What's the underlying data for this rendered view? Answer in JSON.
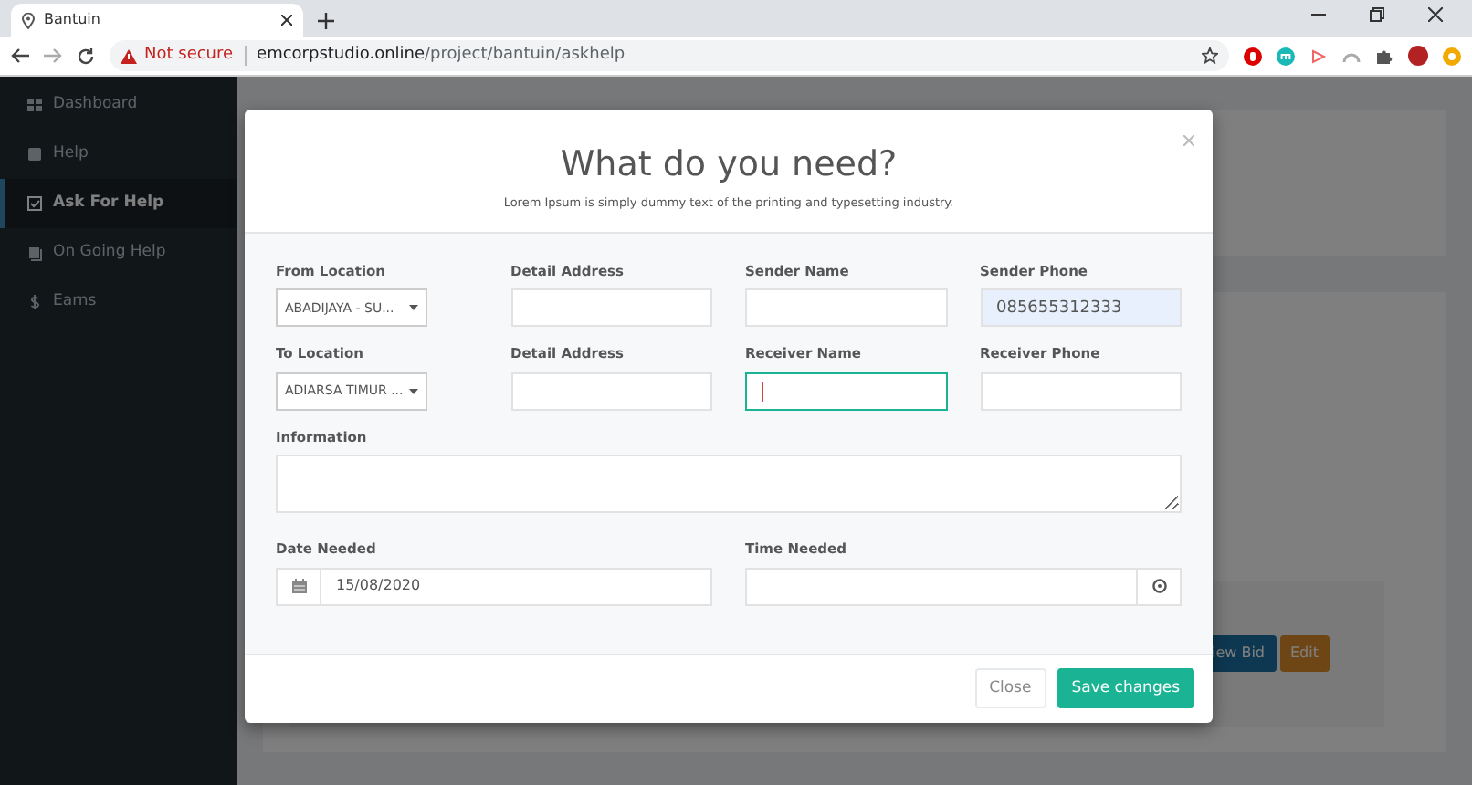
{
  "browser": {
    "tab_title": "Bantuin",
    "url_warning": "Not secure",
    "url_host": "emcorpstudio.online",
    "url_path": "/project/bantuin/askhelp"
  },
  "sidebar": {
    "items": [
      {
        "label": "Dashboard",
        "selected": false
      },
      {
        "label": "Help",
        "selected": false
      },
      {
        "label": "Ask For Help",
        "selected": true
      },
      {
        "label": "On Going Help",
        "selected": false
      },
      {
        "label": "Earns",
        "selected": false
      }
    ]
  },
  "background_buttons": [
    {
      "label": "iew Bid",
      "kind": "primary"
    },
    {
      "label": "Edit",
      "kind": "warning"
    }
  ],
  "modal": {
    "title": "What do you need?",
    "subtitle": "Lorem Ipsum is simply dummy text of the printing and typesetting industry.",
    "address_rows": [
      [
        {
          "kind": "select",
          "label": "From Location",
          "value": "ABADIJAYA - SU...",
          "focused": false,
          "autofilled": false
        },
        {
          "kind": "text",
          "label": "Detail Address",
          "focused": false,
          "autofilled": false
        },
        {
          "kind": "text",
          "label": "Sender Name",
          "focused": false,
          "autofilled": false
        },
        {
          "kind": "text",
          "label": "Sender Phone",
          "value": "085655312333",
          "focused": false,
          "autofilled": true
        }
      ],
      [
        {
          "kind": "select",
          "label": "To Location",
          "value": "ADIARSA TIMUR ...",
          "focused": false,
          "autofilled": false
        },
        {
          "kind": "text",
          "label": "Detail Address",
          "focused": false,
          "autofilled": false
        },
        {
          "kind": "text",
          "label": "Receiver Name",
          "focused": true,
          "autofilled": false
        },
        {
          "kind": "text",
          "label": "Receiver Phone",
          "focused": false,
          "autofilled": false
        }
      ]
    ],
    "information": {
      "label": "Information",
      "focused": false,
      "autofilled": false
    },
    "schedule": [
      {
        "kind": "date",
        "label": "Date Needed",
        "value": "15/08/2020",
        "focused": false,
        "autofilled": false
      },
      {
        "kind": "time",
        "label": "Time Needed",
        "focused": false,
        "autofilled": false
      }
    ],
    "buttons": [
      {
        "label": "Close",
        "kind": "secondary"
      },
      {
        "label": "Save changes",
        "kind": "primary"
      }
    ]
  }
}
